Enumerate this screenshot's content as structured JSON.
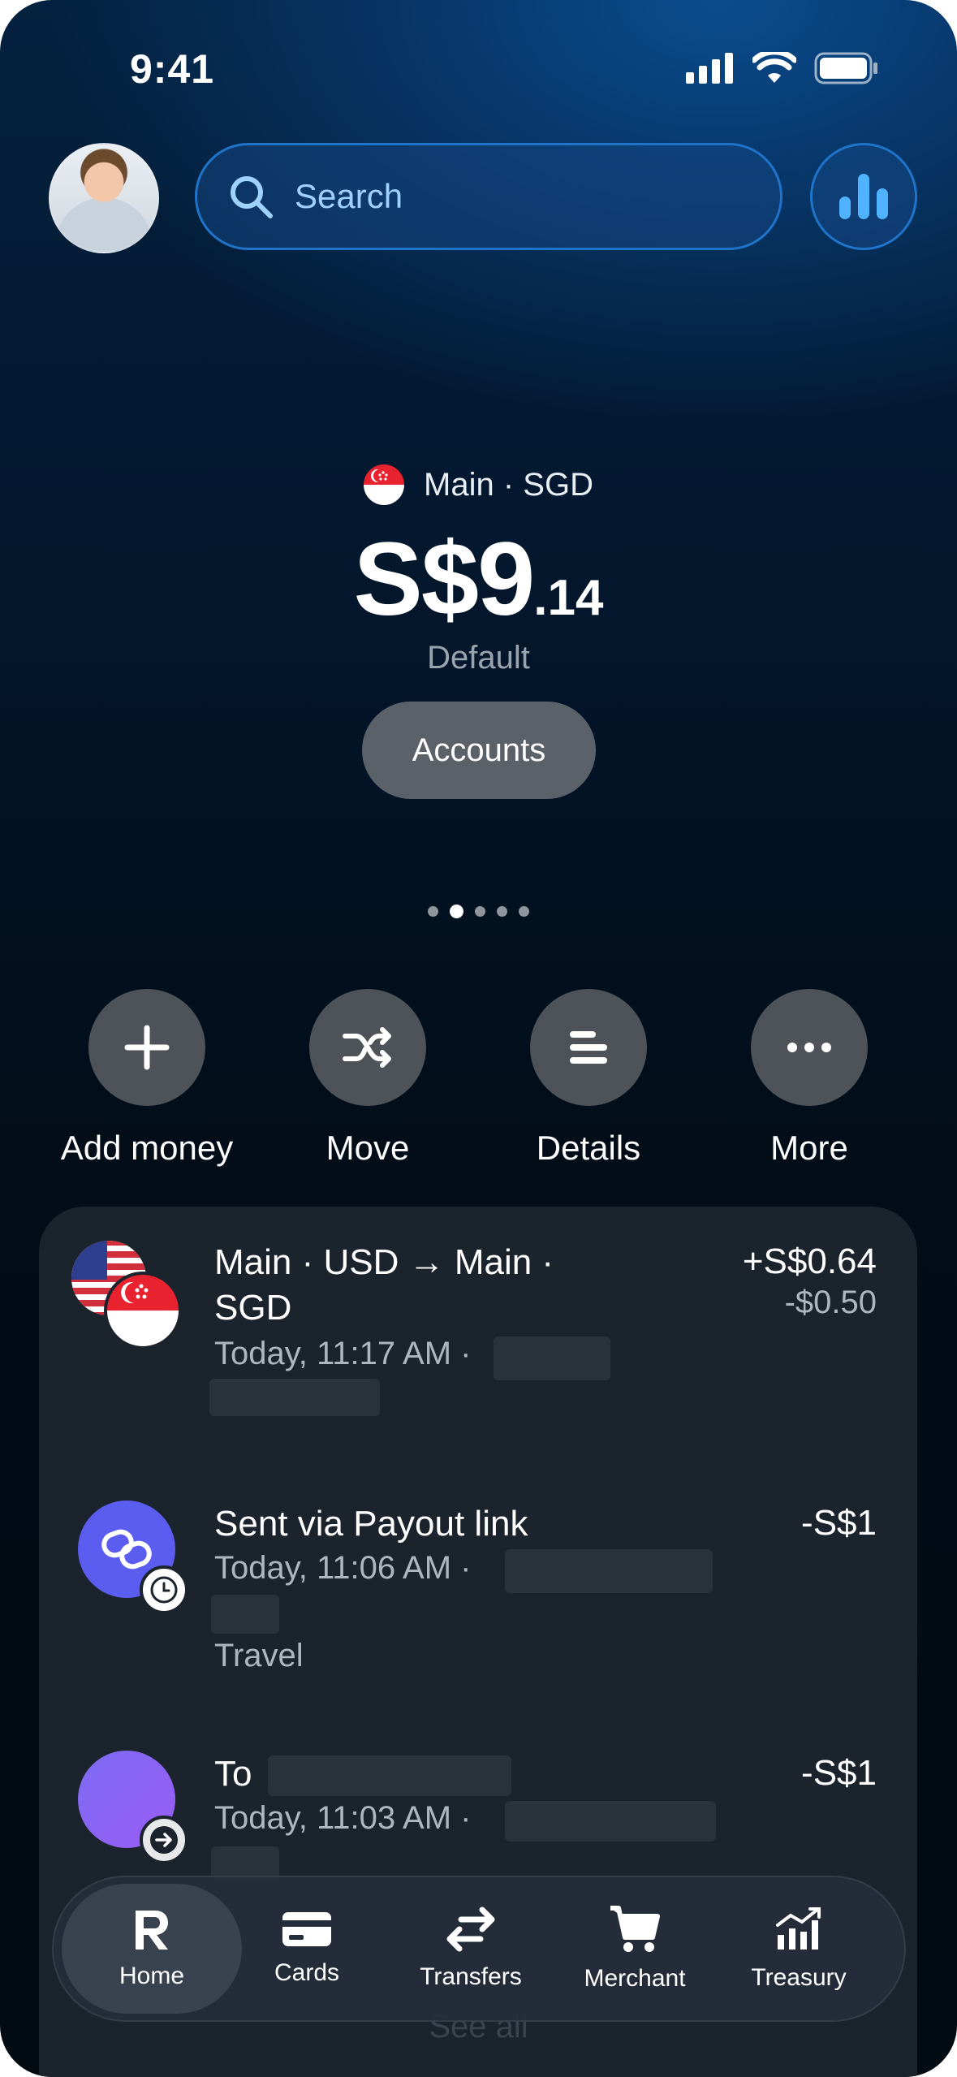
{
  "status_bar": {
    "time": "9:41"
  },
  "header": {
    "search_placeholder": "Search"
  },
  "balance": {
    "account_label": "Main · SGD",
    "amount_main": "S$9",
    "amount_cents": ".14",
    "subtitle": "Default",
    "accounts_button": "Accounts",
    "page_indicator": {
      "count": 5,
      "active_index": 1
    }
  },
  "actions": [
    {
      "label": "Add money",
      "icon": "plus-icon"
    },
    {
      "label": "Move",
      "icon": "shuffle-icon"
    },
    {
      "label": "Details",
      "icon": "list-icon"
    },
    {
      "label": "More",
      "icon": "ellipsis-icon"
    }
  ],
  "transactions": [
    {
      "title_line1": "Main · USD → Main ·",
      "title_line2": "SGD",
      "meta": "Today, 11:17 AM ·",
      "amount": "+S$0.64",
      "amount_secondary": "-$0.50"
    },
    {
      "title_line1": "Sent via Payout link",
      "meta": "Today, 11:06 AM ·",
      "category": "Travel",
      "amount": "-S$1"
    },
    {
      "title_line1": "To",
      "meta": "Today, 11:03 AM ·",
      "amount": "-S$1"
    }
  ],
  "see_all": "See all",
  "nav": [
    {
      "label": "Home",
      "active": true
    },
    {
      "label": "Cards"
    },
    {
      "label": "Transfers"
    },
    {
      "label": "Merchant"
    },
    {
      "label": "Treasury"
    }
  ],
  "colors": {
    "accent_blue": "#1f74c9",
    "payout_icon": "#5b5cf0",
    "contact_icon": "#8b5cf6"
  }
}
